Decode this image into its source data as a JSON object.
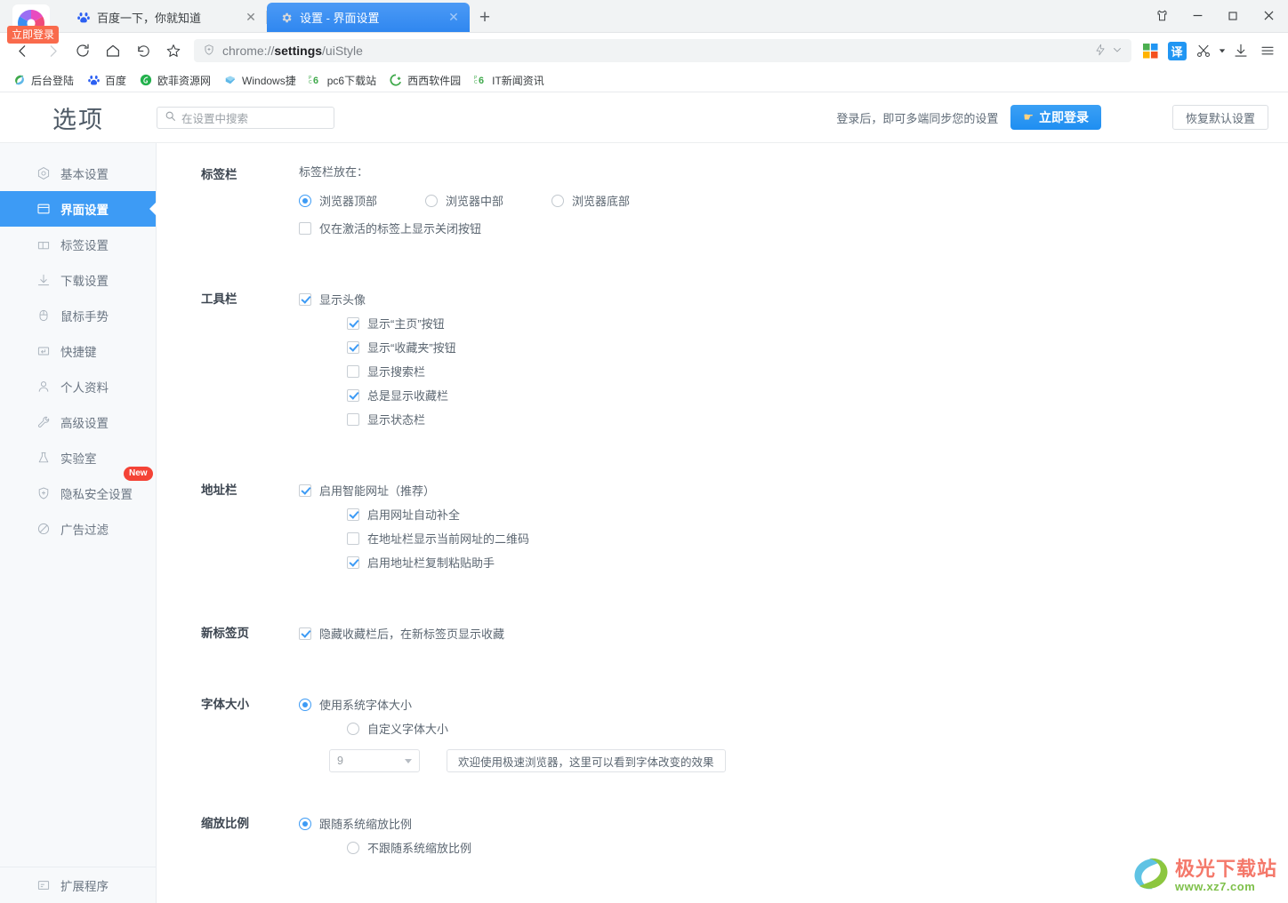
{
  "window": {
    "controls": [
      {
        "name": "skin-icon",
        "glyph": "skin"
      },
      {
        "name": "minimize",
        "glyph": "minimize"
      },
      {
        "name": "maximize",
        "glyph": "maximize"
      },
      {
        "name": "close",
        "glyph": "close"
      }
    ]
  },
  "login_badge": "立即登录",
  "tabs": [
    {
      "title": "百度一下，你就知道",
      "icon": "baidu-paw-icon",
      "active": false,
      "close": "✕"
    },
    {
      "title": "设置 - 界面设置",
      "icon": "gear-icon",
      "active": true,
      "close": "✕"
    }
  ],
  "new_tab_label": "+",
  "toolbar": {
    "back": "back-icon",
    "forward": "forward-icon",
    "reload": "reload-icon",
    "home": "home-icon",
    "restore": "undo-icon",
    "bookmark_star": "star-icon",
    "url_prefix": "chrome://",
    "url_bold": "settings",
    "url_suffix": "/uiStyle",
    "shield": "shield-icon",
    "right_icons": [
      "lightning-icon",
      "chevron-down-icon",
      "apps-grid-icon",
      "translate-icon",
      "scissors-icon",
      "scissors-dropdown-icon",
      "download-icon",
      "menu-icon"
    ],
    "translate_label": "译"
  },
  "bookmarks": [
    {
      "label": "后台登陆",
      "icon": "swirl-icon",
      "color": "#43b649"
    },
    {
      "label": "百度",
      "icon": "baidu-paw-icon",
      "color": "#2c60f2"
    },
    {
      "label": "欧菲资源网",
      "icon": "circle-arrow-icon",
      "color": "#22b14c"
    },
    {
      "label": "Windows捷",
      "icon": "windows-icon",
      "color": "#5fb8e8"
    },
    {
      "label": "pc6下载站",
      "icon": "pc6-icon",
      "color": "#3fa94b"
    },
    {
      "label": "西西软件园",
      "icon": "g-plus-icon",
      "color": "#3fa94b"
    },
    {
      "label": "IT新闻资讯",
      "icon": "pc6-icon",
      "color": "#3fa94b"
    }
  ],
  "header": {
    "brand": "选项",
    "search_placeholder": "在设置中搜索",
    "search_value": "",
    "sync_note": "登录后，即可多端同步您的设置",
    "login_button": "立即登录",
    "login_button_emoji": "☛",
    "reset_button": "恢复默认设置",
    "accent": "#2196f3"
  },
  "sidebar": {
    "items": [
      {
        "label": "基本设置",
        "icon": "hexagon-target-icon",
        "active": false
      },
      {
        "label": "界面设置",
        "icon": "window-icon",
        "active": true
      },
      {
        "label": "标签设置",
        "icon": "tab-icon",
        "active": false
      },
      {
        "label": "下载设置",
        "icon": "download-icon",
        "active": false
      },
      {
        "label": "鼠标手势",
        "icon": "mouse-icon",
        "active": false
      },
      {
        "label": "快捷键",
        "icon": "keyboard-key-icon",
        "active": false
      },
      {
        "label": "个人资料",
        "icon": "person-icon",
        "active": false
      },
      {
        "label": "高级设置",
        "icon": "wrench-icon",
        "active": false
      },
      {
        "label": "实验室",
        "icon": "flask-icon",
        "active": false
      },
      {
        "label": "隐私安全设置",
        "icon": "shield-plus-icon",
        "active": false,
        "badge": "New"
      },
      {
        "label": "广告过滤",
        "icon": "no-entry-icon",
        "active": false
      }
    ],
    "footer": {
      "label": "扩展程序",
      "icon": "extension-icon"
    }
  },
  "sections": {
    "tabbar": {
      "label": "标签栏",
      "sublabel": "标签栏放在：",
      "radios": [
        {
          "label": "浏览器顶部",
          "checked": true
        },
        {
          "label": "浏览器中部",
          "checked": false
        },
        {
          "label": "浏览器底部",
          "checked": false
        }
      ],
      "checkbox": {
        "label": "仅在激活的标签上显示关闭按钮",
        "checked": false
      }
    },
    "toolbar": {
      "label": "工具栏",
      "checkboxes": [
        {
          "label": "显示头像",
          "checked": true
        },
        {
          "label": "显示“主页”按钮",
          "checked": true
        },
        {
          "label": "显示“收藏夹”按钮",
          "checked": true
        },
        {
          "label": "显示搜索栏",
          "checked": false
        },
        {
          "label": "总是显示收藏栏",
          "checked": true
        },
        {
          "label": "显示状态栏",
          "checked": false
        }
      ]
    },
    "addressbar": {
      "label": "地址栏",
      "checkboxes": [
        {
          "label": "启用智能网址（推荐）",
          "checked": true
        },
        {
          "label": "启用网址自动补全",
          "checked": true
        },
        {
          "label": "在地址栏显示当前网址的二维码",
          "checked": false
        },
        {
          "label": "启用地址栏复制粘贴助手",
          "checked": true
        }
      ]
    },
    "newtab": {
      "label": "新标签页",
      "checkboxes": [
        {
          "label": "隐藏收藏栏后，在新标签页显示收藏",
          "checked": true
        }
      ]
    },
    "fontsize": {
      "label": "字体大小",
      "radios": [
        {
          "label": "使用系统字体大小",
          "checked": true
        },
        {
          "label": "自定义字体大小",
          "checked": false
        }
      ],
      "select_value": "9",
      "preview_text": "欢迎使用极速浏览器，这里可以看到字体改变的效果"
    },
    "zoomratio": {
      "label": "缩放比例",
      "radios": [
        {
          "label": "跟随系统缩放比例",
          "checked": true
        },
        {
          "label": "不跟随系统缩放比例",
          "checked": false
        }
      ]
    }
  },
  "watermark": {
    "title": "极光下载站",
    "url": "www.xz7.com"
  }
}
